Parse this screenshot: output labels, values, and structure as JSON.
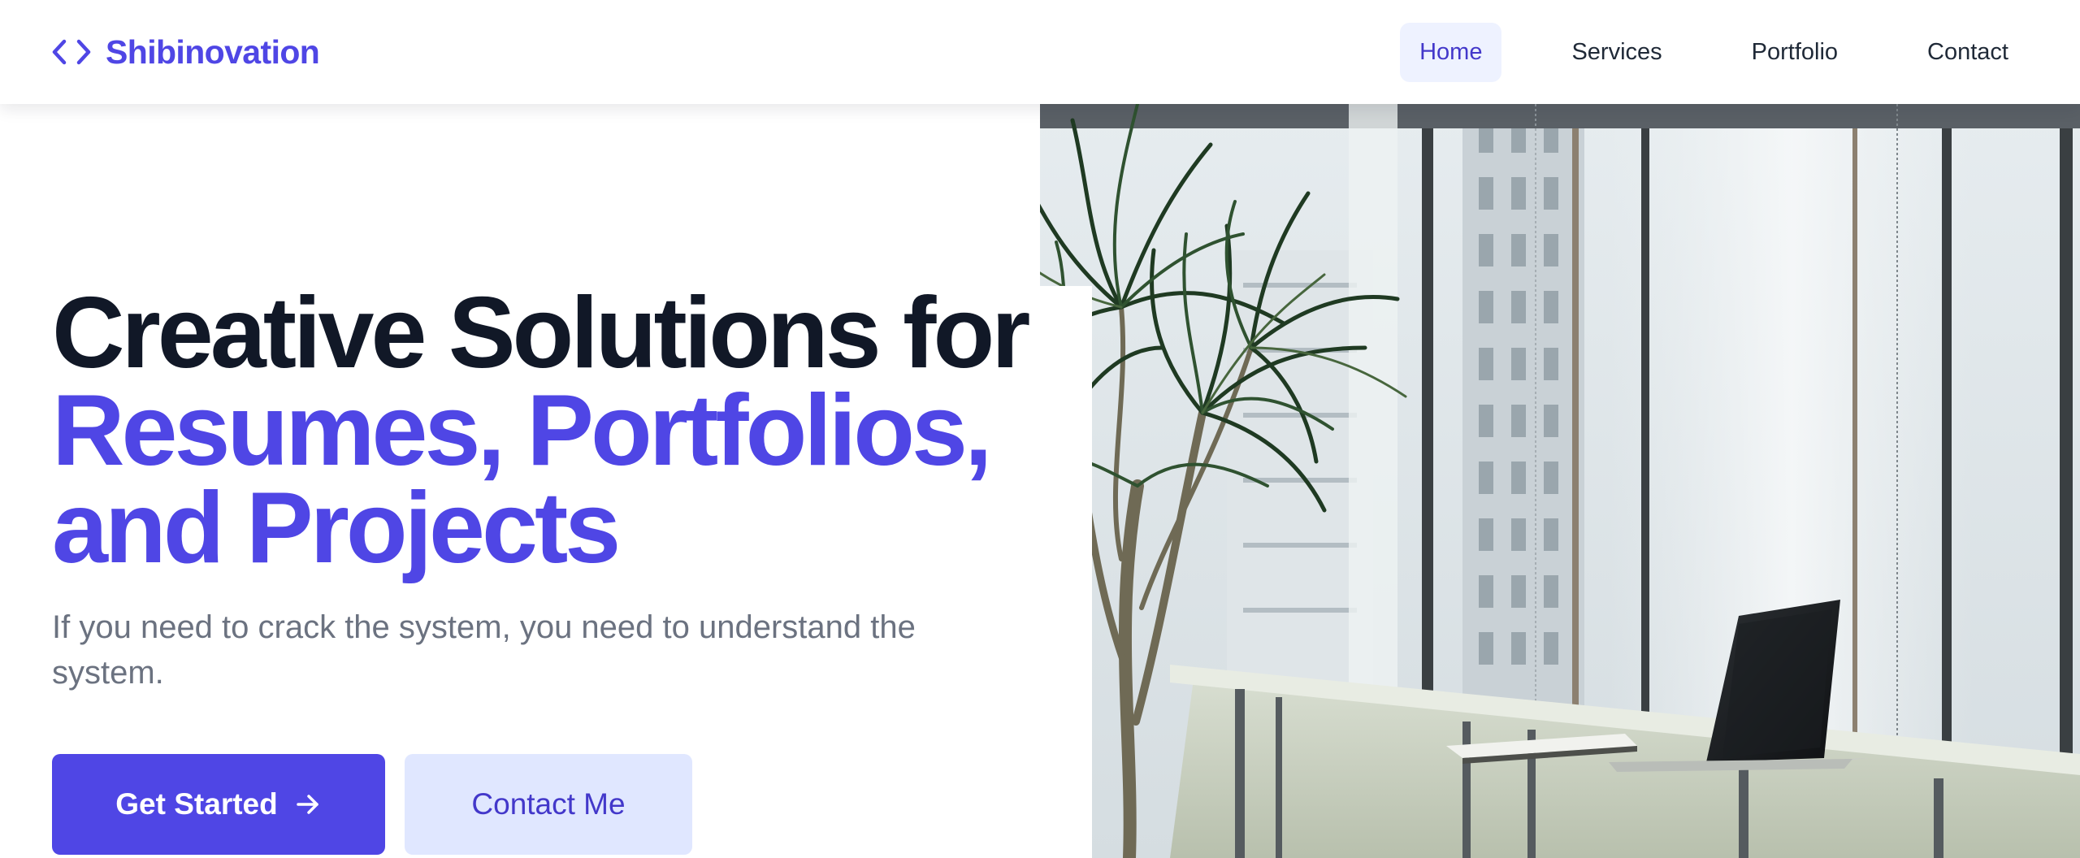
{
  "brand": {
    "name": "Shibinovation",
    "icon": "code-brackets-icon",
    "color": "#4f46e5"
  },
  "nav": {
    "items": [
      {
        "label": "Home",
        "active": true
      },
      {
        "label": "Services",
        "active": false
      },
      {
        "label": "Portfolio",
        "active": false
      },
      {
        "label": "Contact",
        "active": false
      }
    ]
  },
  "hero": {
    "title_line1": "Creative Solutions for",
    "title_line2": "Resumes, Portfolios,",
    "title_line3": "and Projects",
    "subtitle": "If you need to crack the system, you need to understand the system.",
    "primary_button": "Get Started",
    "primary_button_icon": "arrow-right-icon",
    "secondary_button": "Contact Me"
  },
  "colors": {
    "accent": "#4f46e5",
    "heading": "#111827",
    "muted": "#6b7280",
    "secondary_button_bg": "#e0e7ff"
  }
}
